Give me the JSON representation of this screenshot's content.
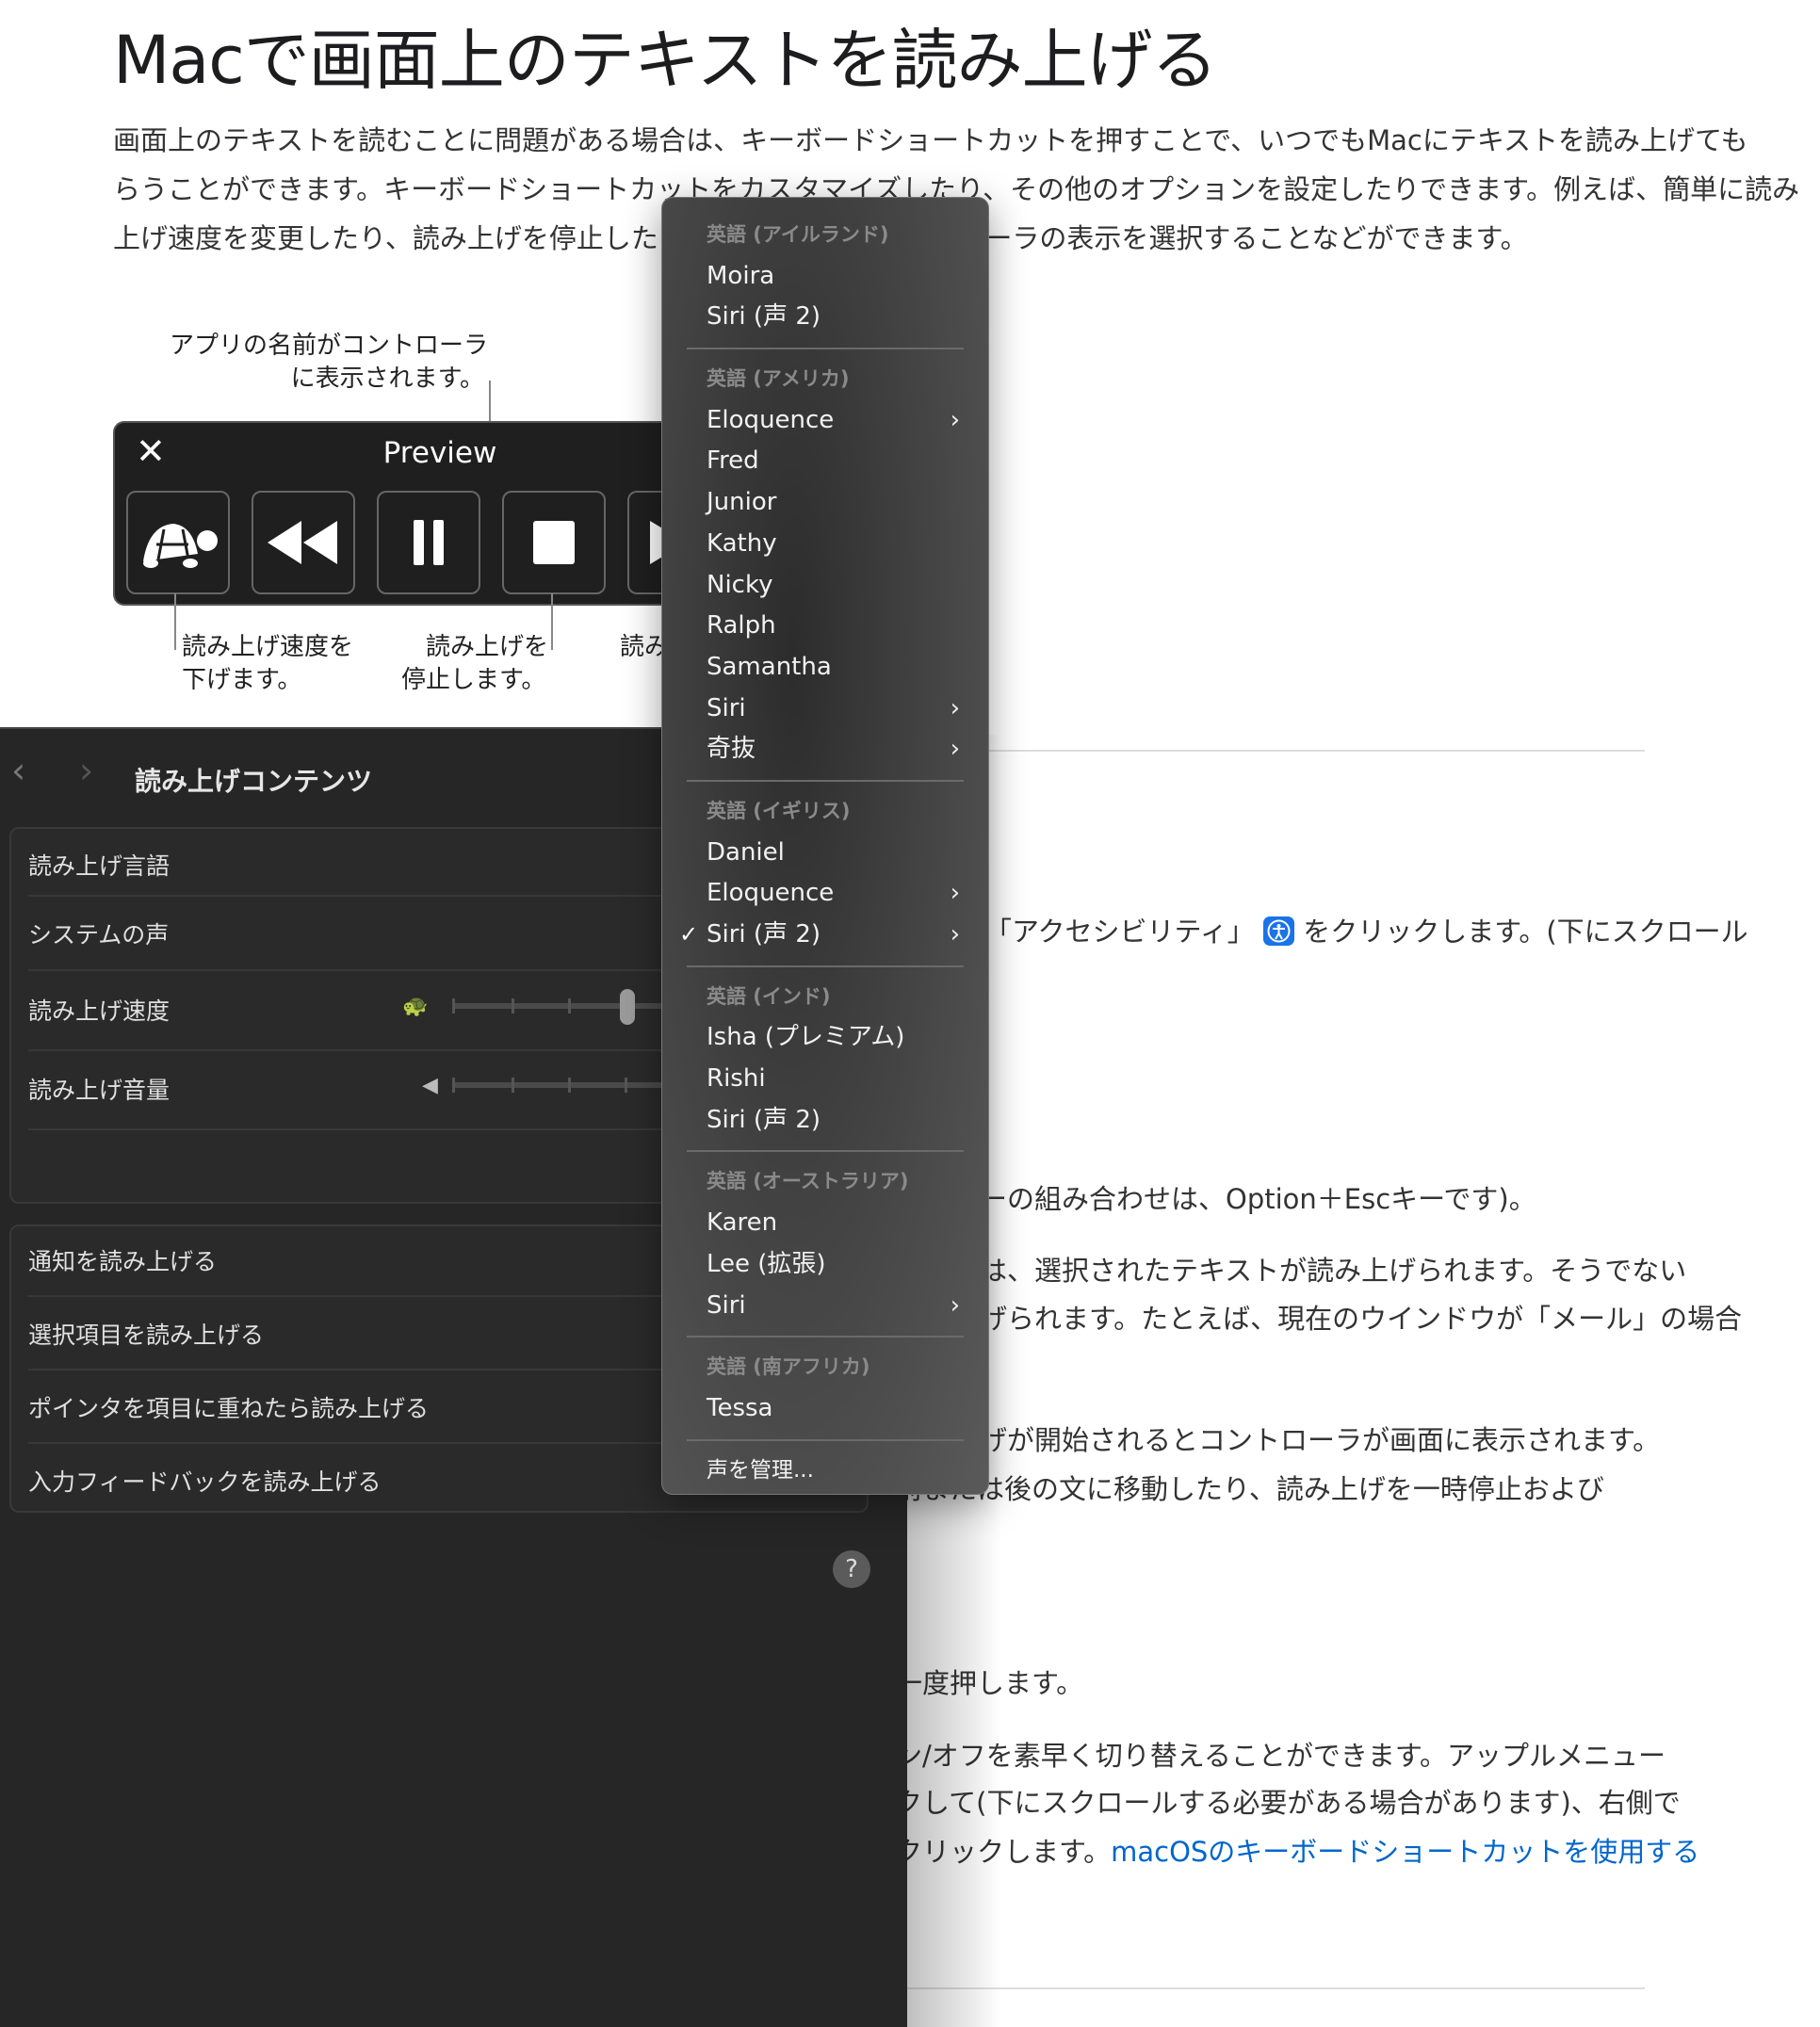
{
  "page": {
    "title": "Macで画面上のテキストを読み上げる",
    "intro": [
      "画面上のテキストを読むことに問題がある場合は、キーボードショートカットを押すことで、いつでもMacにテキストを読み上げても",
      "らうことができます。キーボードショートカットをカスタマイズしたり、その他のオプションを設定したりできます。例えば、簡単に読み",
      "上げ速度を変更したり、読み上げを停止したりできるように、コントローラの表示を選択することなどができます。"
    ],
    "right_fragments": {
      "accessibility_before": "「アクセシビリティ」",
      "accessibility_after": "をクリックします。(下にスクロール",
      "option_esc": "ーの組み合わせは、Option＋Escキーです)。",
      "selected_1": "は、選択されたテキストが読み上げられます。そうでない",
      "selected_2": "げられます。たとえば、現在のウインドウが「メール」の場合",
      "controller_1": "げが開始されるとコントローラが画面に表示されます。",
      "controller_2": "前または後の文に移動したり、読み上げを一時停止および",
      "press_again": "一度押します。",
      "toggle_1": "ン/オフを素早く切り替えることができます。アップルメニュー",
      "toggle_2": "クして(下にスクロールする必要がある場合があります)、右側で",
      "toggle_3": "クリックします。",
      "link": "macOSのキーボードショートカットを使用する"
    },
    "link_color": "#0066cc",
    "accessibility_icon_color": "#1a73e8"
  },
  "figure": {
    "callout_app_name": [
      "アプリの名前がコントローラ",
      "に表示されます。"
    ],
    "callout_slow": [
      "読み上げ速度を",
      "下げます。"
    ],
    "callout_stop": [
      "読み上げを",
      "停止します。"
    ],
    "callout_partial": "読み",
    "controller": {
      "app_name": "Preview",
      "buttons": [
        "turtle-icon",
        "rewind-icon",
        "pause-icon",
        "stop-icon",
        "play-icon"
      ]
    }
  },
  "settings": {
    "title": "読み上げコンテンツ",
    "group1": [
      "読み上げ言語",
      "システムの声",
      "読み上げ速度",
      "読み上げ音量"
    ],
    "speech_rate_position": 0.4,
    "group2": [
      "通知を読み上げる",
      "選択項目を読み上げる",
      "ポインタを項目に重ねたら読み上げる",
      "入力フィードバックを読み上げる"
    ],
    "help": "?"
  },
  "voice_menu": {
    "selected": "英語(イギリス) / Siri (声 2)",
    "sections": [
      {
        "header": "英語 (アイルランド)",
        "items": [
          {
            "label": "Moira"
          },
          {
            "label": "Siri (声 2)"
          }
        ]
      },
      {
        "header": "英語 (アメリカ)",
        "items": [
          {
            "label": "Eloquence",
            "submenu": true
          },
          {
            "label": "Fred"
          },
          {
            "label": "Junior"
          },
          {
            "label": "Kathy"
          },
          {
            "label": "Nicky"
          },
          {
            "label": "Ralph"
          },
          {
            "label": "Samantha"
          },
          {
            "label": "Siri",
            "submenu": true
          },
          {
            "label": "奇抜",
            "submenu": true
          }
        ]
      },
      {
        "header": "英語 (イギリス)",
        "items": [
          {
            "label": "Daniel"
          },
          {
            "label": "Eloquence",
            "submenu": true
          },
          {
            "label": "Siri (声 2)",
            "submenu": true,
            "checked": true
          }
        ]
      },
      {
        "header": "英語 (インド)",
        "items": [
          {
            "label": "Isha (プレミアム)"
          },
          {
            "label": "Rishi"
          },
          {
            "label": "Siri (声 2)"
          }
        ]
      },
      {
        "header": "英語 (オーストラリア)",
        "items": [
          {
            "label": "Karen"
          },
          {
            "label": "Lee (拡張)"
          },
          {
            "label": "Siri",
            "submenu": true
          }
        ]
      },
      {
        "header": "英語 (南アフリカ)",
        "items": [
          {
            "label": "Tessa"
          }
        ]
      }
    ],
    "manage": "声を管理..."
  }
}
